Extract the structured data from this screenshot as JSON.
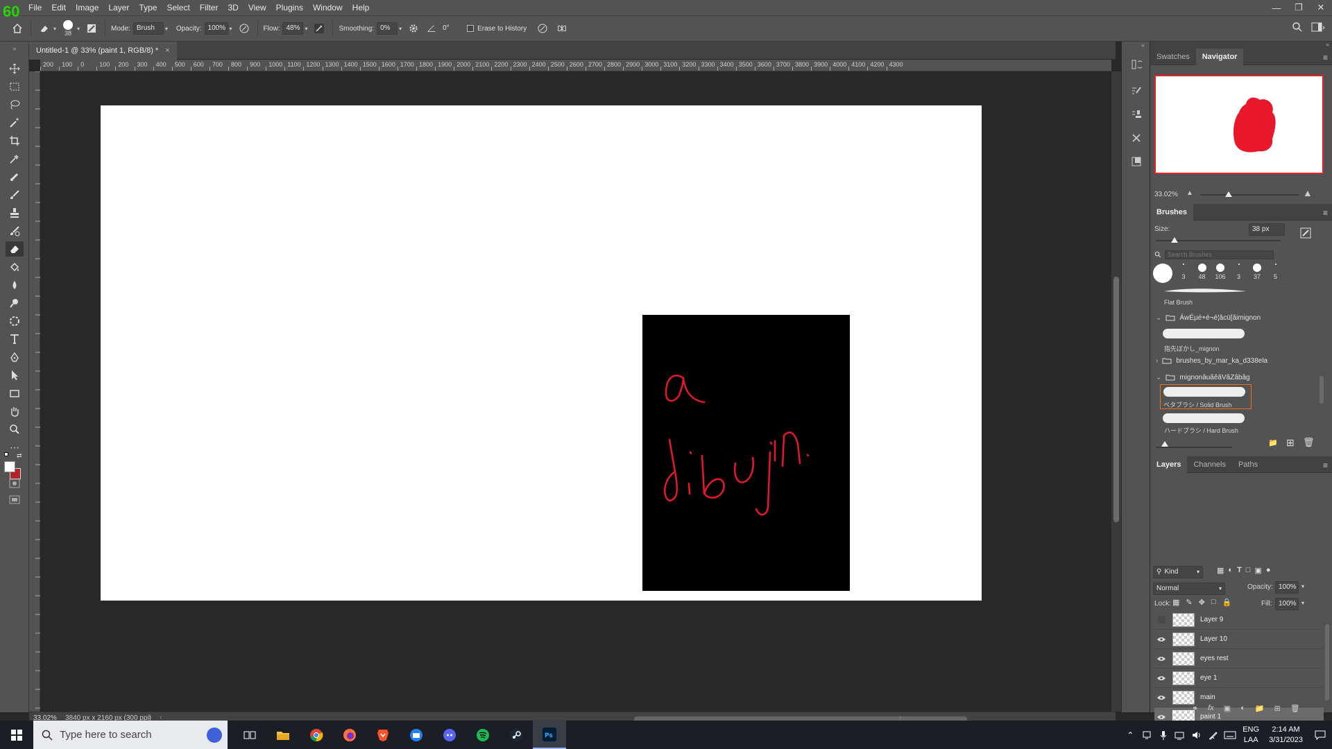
{
  "window": {
    "fps": "60",
    "menus": [
      "File",
      "Edit",
      "Image",
      "Layer",
      "Type",
      "Select",
      "Filter",
      "3D",
      "View",
      "Plugins",
      "Window",
      "Help"
    ]
  },
  "options": {
    "brush_size": "38",
    "mode_label": "Mode:",
    "mode_value": "Brush",
    "opacity_label": "Opacity:",
    "opacity_value": "100%",
    "flow_label": "Flow:",
    "flow_value": "48%",
    "smoothing_label": "Smoothing:",
    "smoothing_value": "0%",
    "angle_value": "0°",
    "erase_history_label": "Erase to History"
  },
  "document": {
    "tab_title": "Untitled-1 @ 33% (paint 1, RGB/8) *",
    "ruler_ticks": [
      "200",
      "100",
      "0",
      "100",
      "200",
      "300",
      "400",
      "500",
      "600",
      "700",
      "800",
      "900",
      "1000",
      "1100",
      "1200",
      "1300",
      "1400",
      "1500",
      "1600",
      "1700",
      "1800",
      "1900",
      "2000",
      "2100",
      "2200",
      "2300",
      "2400",
      "2500",
      "2600",
      "2700",
      "2800",
      "2900",
      "3000",
      "3100",
      "3200",
      "3300",
      "3400",
      "3500",
      "3600",
      "3700",
      "3800",
      "3900",
      "4000",
      "4100",
      "4200",
      "4300"
    ],
    "zoom": "33.02%",
    "doc_info": "3840 px x 2160 px (300 ppi)",
    "stroke_color": "#e8182a"
  },
  "navigator": {
    "tabs": [
      "Swatches",
      "Navigator"
    ],
    "zoom": "33.02%"
  },
  "brushes": {
    "title": "Brushes",
    "size_label": "Size:",
    "size_value": "38 px",
    "search_placeholder": "Search Brushes",
    "recent": [
      "3",
      "48",
      "106",
      "3",
      "37",
      "5"
    ],
    "items": [
      {
        "label": "Flat Brush"
      },
      {
        "folder": "ÁwÉµé+é¬é¦âcü[âimignon"
      },
      {
        "label": "指先ぼかし_mignon"
      },
      {
        "folder": "brushes_by_mar_ka_d338ela"
      },
      {
        "folder": "mignonâuâêâVâZâbâg"
      },
      {
        "label": "ベタブラシ / Solid Brush"
      },
      {
        "label": "ハードブラシ / Hard Brush"
      }
    ]
  },
  "layers": {
    "tabs": [
      "Layers",
      "Channels",
      "Paths"
    ],
    "kind_label": "Kind",
    "blend_mode": "Normal",
    "opacity_label": "Opacity:",
    "opacity_value": "100%",
    "lock_label": "Lock:",
    "fill_label": "Fill:",
    "fill_value": "100%",
    "list": [
      "Layer 9",
      "Layer 10",
      "eyes rest",
      "eye 1",
      "main",
      "paint 1"
    ]
  },
  "taskbar": {
    "search_placeholder": "Type here to search",
    "lang_top": "ENG",
    "lang_bottom": "LAA",
    "time": "2:14 AM",
    "date": "3/31/2023"
  }
}
